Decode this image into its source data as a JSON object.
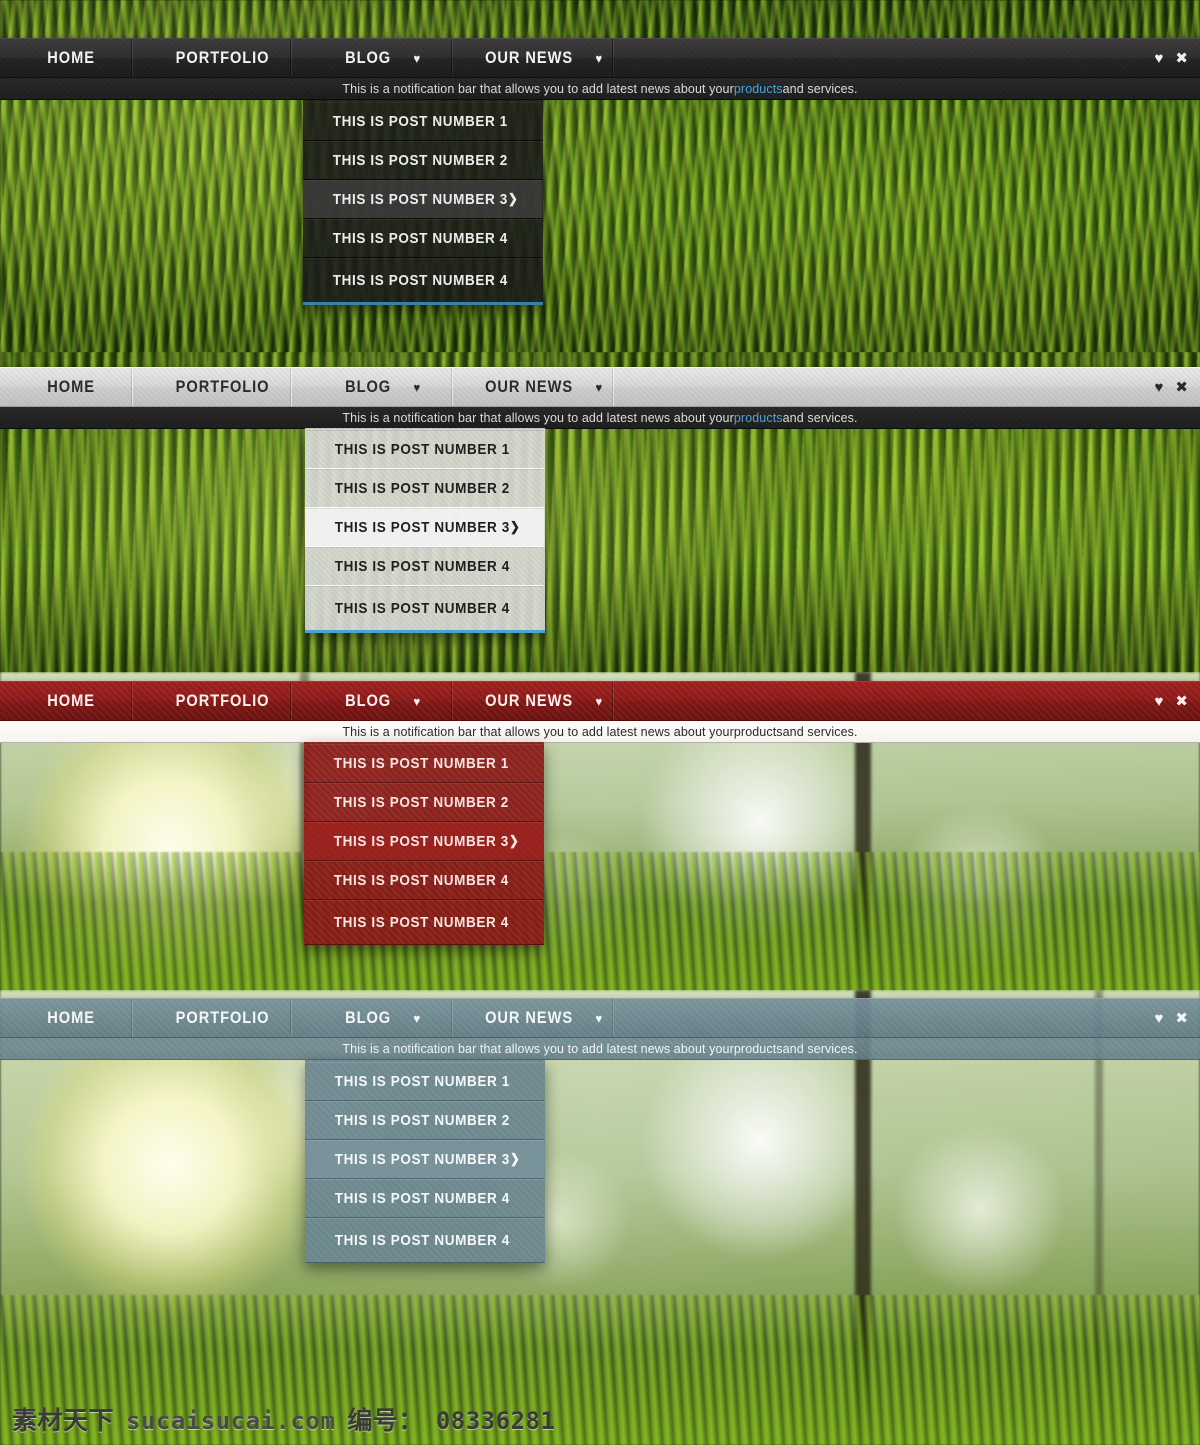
{
  "nav": {
    "items": [
      {
        "label": "HOME",
        "has_caret": false
      },
      {
        "label": "PORTFOLIO",
        "has_caret": false
      },
      {
        "label": "BLOG",
        "has_caret": true
      },
      {
        "label": "OUR NEWS",
        "has_caret": true
      }
    ],
    "caret_glyph": "♥",
    "controls": {
      "collapse_glyph": "♥",
      "close_glyph": "✖"
    }
  },
  "notification": {
    "text_before": "This is a notification bar that allows you to add latest news about your ",
    "link_text": "products",
    "text_after": " and services."
  },
  "dropdown": {
    "items": [
      {
        "label": "THIS IS POST NUMBER 1",
        "submenu": false,
        "active": false
      },
      {
        "label": "THIS IS POST NUMBER 2",
        "submenu": false,
        "active": false
      },
      {
        "label": "THIS IS POST NUMBER 3",
        "submenu": true,
        "active": true
      },
      {
        "label": "THIS IS POST NUMBER 4",
        "submenu": false,
        "active": false
      },
      {
        "label": "THIS IS POST NUMBER 4",
        "submenu": false,
        "active": false
      }
    ],
    "submenu_arrow": "❯"
  },
  "themes": [
    {
      "id": "dark",
      "name": "dark-theme",
      "accent": "#3d7fa8",
      "bar_bg": "#2d2d2d",
      "notif_link": true
    },
    {
      "id": "light",
      "name": "light-theme",
      "accent": "#4aa3d4",
      "bar_bg": "#d8d8d8",
      "notif_link": true
    },
    {
      "id": "red",
      "name": "red-theme",
      "accent": "#881614",
      "bar_bg": "#8b1a18",
      "notif_link": false
    },
    {
      "id": "slate",
      "name": "slate-theme",
      "accent": "#68838d",
      "bar_bg": "#748e97",
      "notif_link": false
    }
  ],
  "watermark": {
    "brand": "素材天下",
    "site": "sucaisucai.com",
    "id_label": "编号：",
    "id_value": "08336281"
  }
}
